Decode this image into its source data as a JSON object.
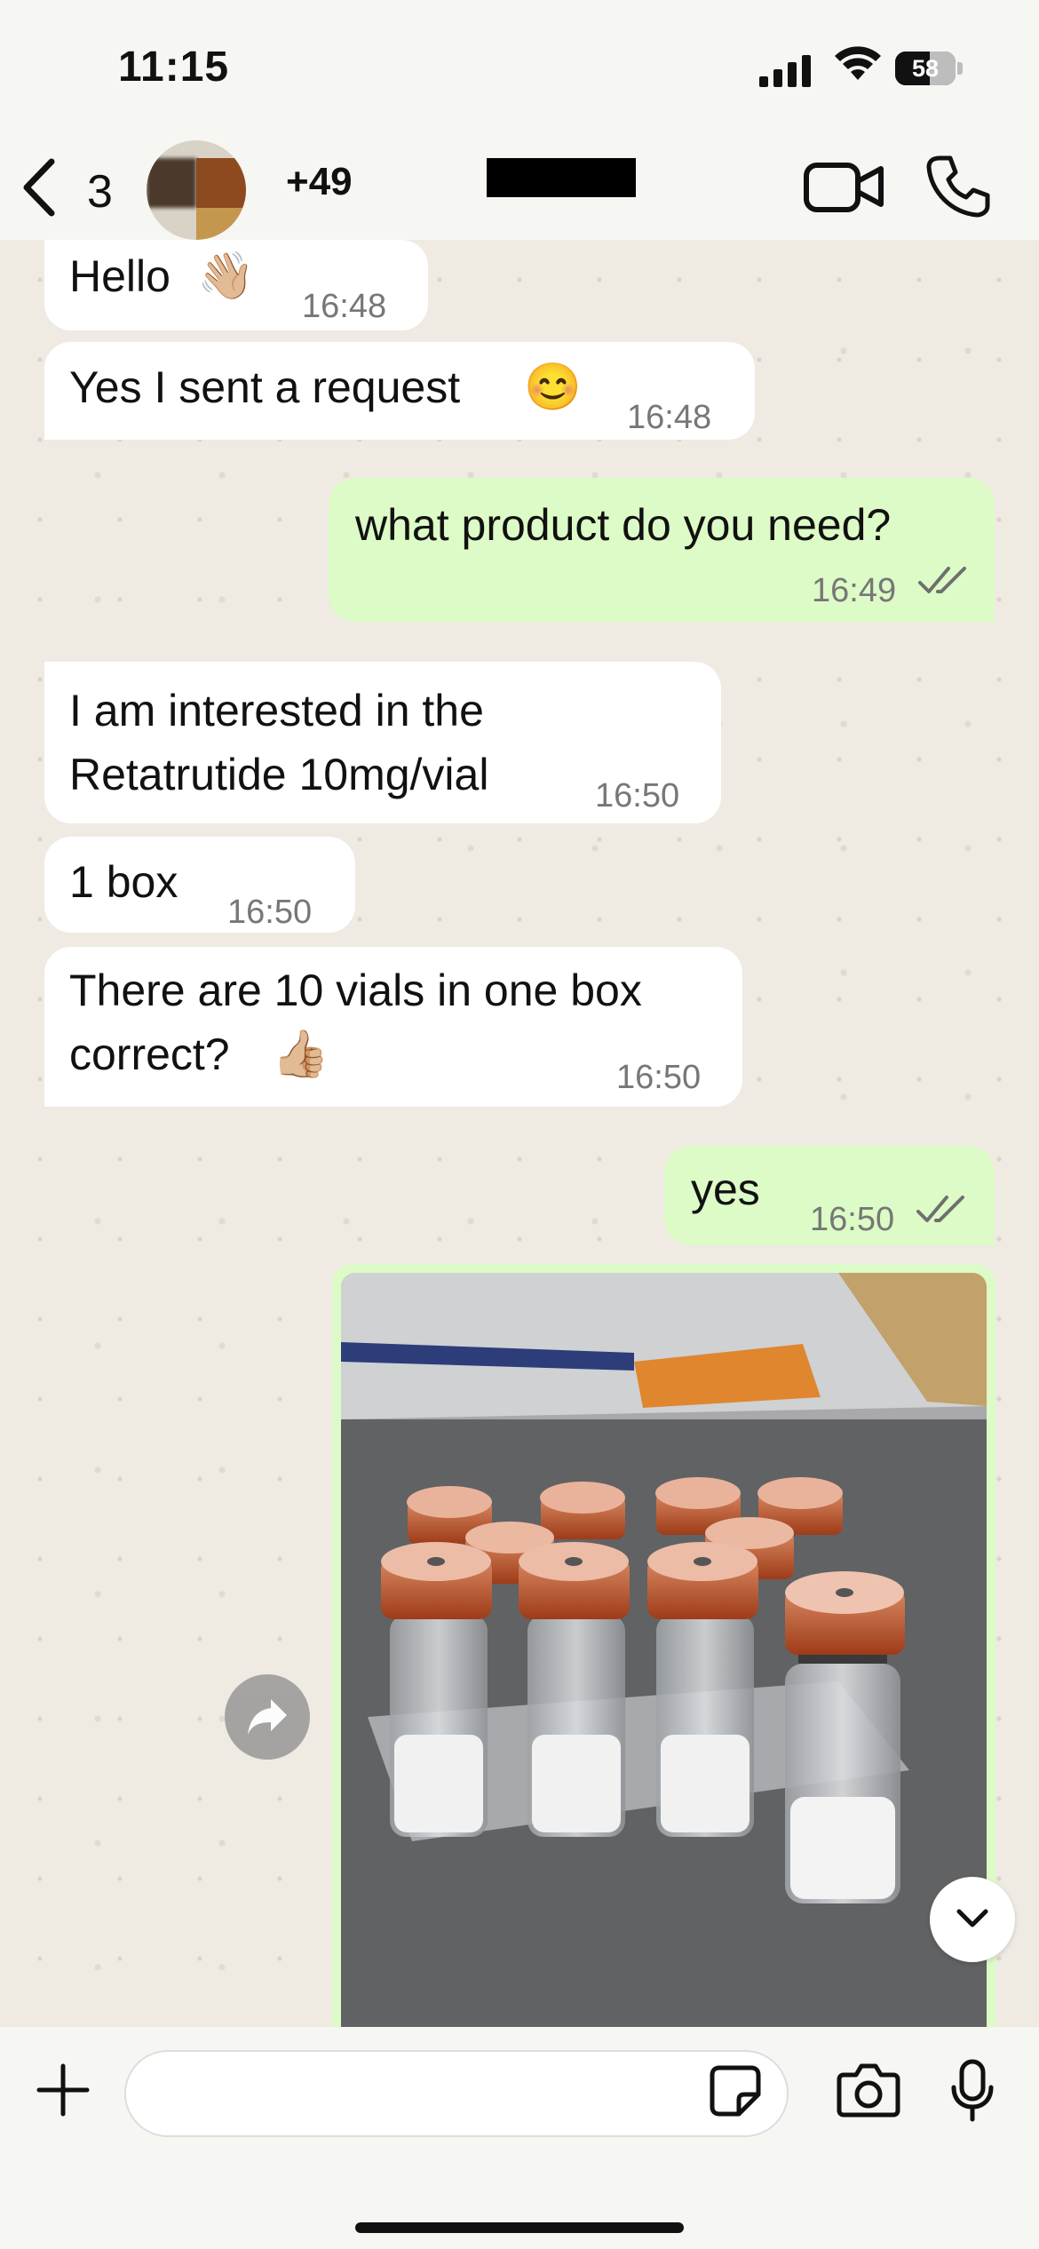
{
  "status_bar": {
    "time": "11:15",
    "battery": "58",
    "battery_level": 0.58
  },
  "header": {
    "back_count": "3",
    "contact_name": "+49"
  },
  "messages": [
    {
      "direction": "in",
      "text": "Hello",
      "emoji": "👋🏼",
      "time": "16:48"
    },
    {
      "direction": "in",
      "text": "Yes I sent a request",
      "emoji": "😊",
      "time": "16:48"
    },
    {
      "direction": "out",
      "text": "what product do you need?",
      "time": "16:49",
      "status": "read"
    },
    {
      "direction": "in",
      "text_lines": [
        "I am interested in the",
        "Retatrutide 10mg/vial"
      ],
      "time": "16:50"
    },
    {
      "direction": "in",
      "text": "1 box",
      "time": "16:50"
    },
    {
      "direction": "in",
      "text_lines": [
        "There are 10 vials in one box",
        "correct?"
      ],
      "emoji": "👍🏼",
      "time": "16:50"
    },
    {
      "direction": "out",
      "text": "yes",
      "time": "16:50",
      "status": "read"
    },
    {
      "direction": "out",
      "type": "image",
      "image_desc": "photo-vials"
    }
  ],
  "icons": {
    "back": "chevron-left-icon",
    "video": "video-camera-icon",
    "call": "phone-icon",
    "forward": "forward-arrow-icon",
    "scroll": "chevron-down-icon",
    "plus": "plus-icon",
    "sticker": "sticker-icon",
    "camera": "camera-icon",
    "mic": "microphone-icon"
  },
  "composer": {
    "placeholder": ""
  },
  "colors": {
    "incoming": "#ffffff",
    "outgoing": "#dcfbc6",
    "chat_bg": "#efeae2",
    "tick": "#6f6f6f"
  }
}
